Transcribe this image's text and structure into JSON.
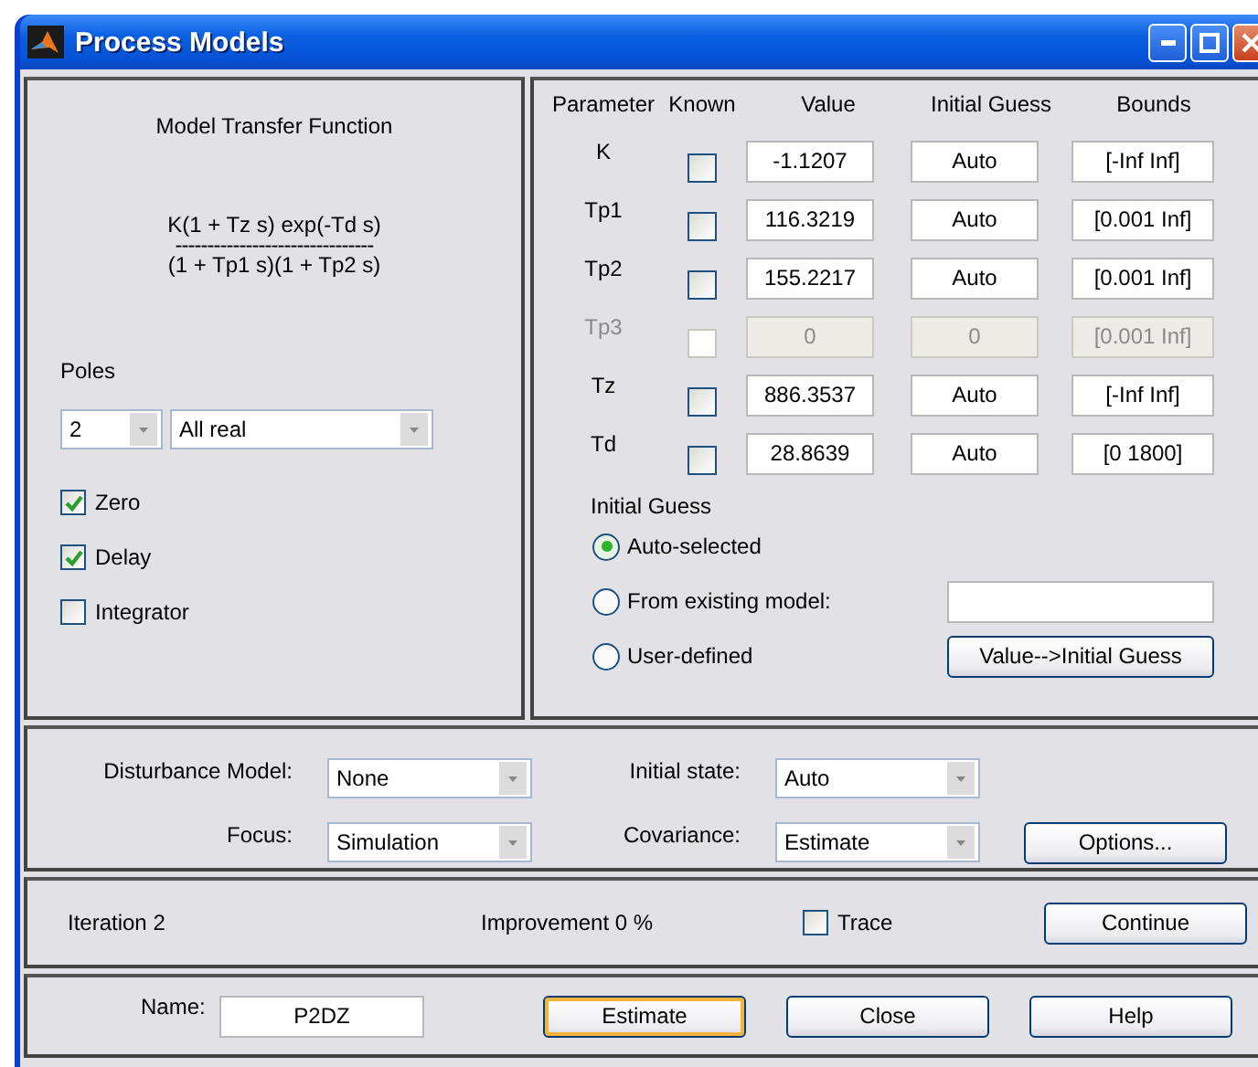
{
  "window": {
    "title": "Process Models"
  },
  "transfer_function": {
    "title": "Model Transfer Function",
    "numerator": "K(1 + Tz s) exp(-Td s)",
    "divider": "-------------------------------",
    "denominator": "(1 + Tp1 s)(1 + Tp2 s)"
  },
  "poles": {
    "label": "Poles",
    "count": "2",
    "type": "All real"
  },
  "options": [
    {
      "label": "Zero",
      "checked": true
    },
    {
      "label": "Delay",
      "checked": true
    },
    {
      "label": "Integrator",
      "checked": false
    }
  ],
  "parameters": {
    "columns": [
      "Parameter",
      "Known",
      "Value",
      "Initial Guess",
      "Bounds"
    ],
    "rows": [
      {
        "name": "K",
        "known": false,
        "value": "-1.1207",
        "initial_guess": "Auto",
        "bounds": "[-Inf Inf]",
        "disabled": false
      },
      {
        "name": "Tp1",
        "known": false,
        "value": "116.3219",
        "initial_guess": "Auto",
        "bounds": "[0.001 Inf]",
        "disabled": false
      },
      {
        "name": "Tp2",
        "known": false,
        "value": "155.2217",
        "initial_guess": "Auto",
        "bounds": "[0.001 Inf]",
        "disabled": false
      },
      {
        "name": "Tp3",
        "known": false,
        "value": "0",
        "initial_guess": "0",
        "bounds": "[0.001 Inf]",
        "disabled": true
      },
      {
        "name": "Tz",
        "known": false,
        "value": "886.3537",
        "initial_guess": "Auto",
        "bounds": "[-Inf Inf]",
        "disabled": false
      },
      {
        "name": "Td",
        "known": false,
        "value": "28.8639",
        "initial_guess": "Auto",
        "bounds": "[0 1800]",
        "disabled": false
      }
    ]
  },
  "initial_guess": {
    "title": "Initial Guess",
    "choices": [
      {
        "label": "Auto-selected",
        "selected": true
      },
      {
        "label": "From existing model:",
        "selected": false
      },
      {
        "label": "User-defined",
        "selected": false
      }
    ],
    "button": "Value-->Initial Guess"
  },
  "estimation": {
    "disturbance_label": "Disturbance Model:",
    "disturbance": "None",
    "focus_label": "Focus:",
    "focus": "Simulation",
    "initial_state_label": "Initial state:",
    "initial_state": "Auto",
    "covariance_label": "Covariance:",
    "covariance": "Estimate",
    "options_button": "Options..."
  },
  "iteration": {
    "label": "Iteration 2",
    "improvement": "Improvement 0 %",
    "trace": {
      "label": "Trace",
      "checked": false
    },
    "button": "Continue"
  },
  "footer": {
    "name_label": "Name:",
    "name": "P2DZ",
    "buttons": [
      {
        "label": "Estimate",
        "default": true
      },
      {
        "label": "Close",
        "default": false
      },
      {
        "label": "Help",
        "default": false
      }
    ]
  }
}
